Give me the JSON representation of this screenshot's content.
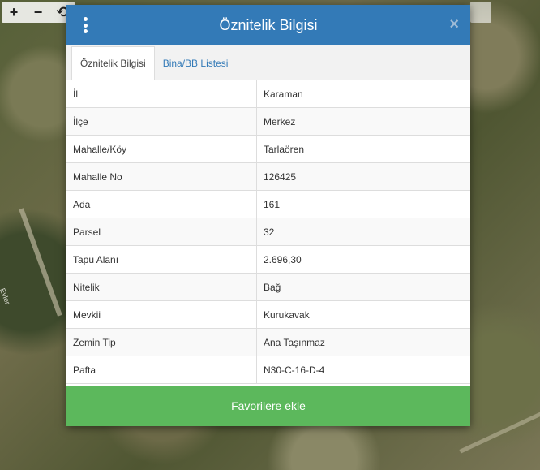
{
  "map": {
    "zoom_in": "+",
    "zoom_out": "−",
    "rotate": "⟲",
    "road_label": "Evler"
  },
  "modal": {
    "title": "Öznitelik Bilgisi",
    "close": "×",
    "tabs": [
      {
        "label": "Öznitelik Bilgisi",
        "active": true
      },
      {
        "label": "Bina/BB Listesi",
        "active": false
      }
    ],
    "rows": [
      {
        "key": "İl",
        "value": "Karaman"
      },
      {
        "key": "İlçe",
        "value": "Merkez"
      },
      {
        "key": "Mahalle/Köy",
        "value": "Tarlaören"
      },
      {
        "key": "Mahalle No",
        "value": "126425"
      },
      {
        "key": "Ada",
        "value": "161"
      },
      {
        "key": "Parsel",
        "value": "32"
      },
      {
        "key": "Tapu Alanı",
        "value": "2.696,30"
      },
      {
        "key": "Nitelik",
        "value": "Bağ"
      },
      {
        "key": "Mevkii",
        "value": "Kurukavak"
      },
      {
        "key": "Zemin Tip",
        "value": "Ana Taşınmaz"
      },
      {
        "key": "Pafta",
        "value": "N30-C-16-D-4"
      }
    ],
    "favorite_button": "Favorilere ekle"
  },
  "colors": {
    "header": "#337ab7",
    "button": "#5cb85c"
  }
}
